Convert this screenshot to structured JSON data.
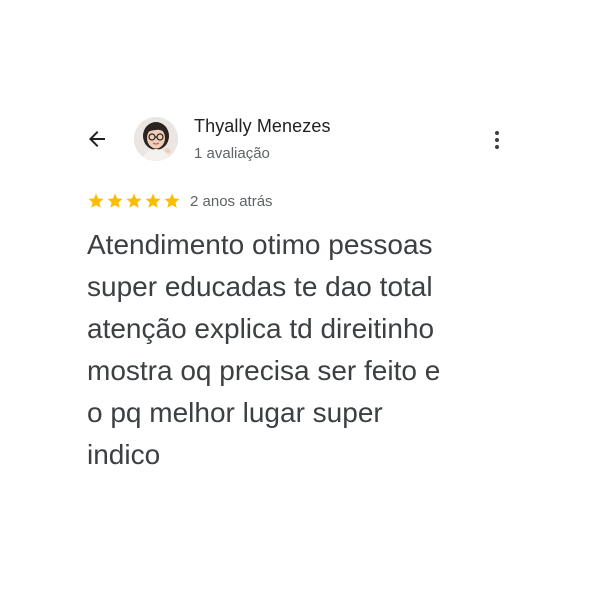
{
  "reviewer": {
    "name": "Thyally Menezes",
    "review_count": "1 avaliação"
  },
  "review": {
    "rating": 5,
    "rating_max": 5,
    "date": "2 anos atrás",
    "text_lines": [
      "Atendimento otimo pessoas",
      "super educadas te dao total",
      "atenção explica td direitinho",
      "mostra oq precisa ser feito e",
      "o pq melhor lugar super",
      "indico"
    ]
  },
  "icons": {
    "back": "arrow-back-icon",
    "more": "more-vertical-icon",
    "star": "star-icon"
  },
  "colors": {
    "star": "#fbbc04",
    "name": "#202124",
    "secondary_text": "#5f6368",
    "body_text": "#3c4043",
    "background": "#ffffff"
  }
}
